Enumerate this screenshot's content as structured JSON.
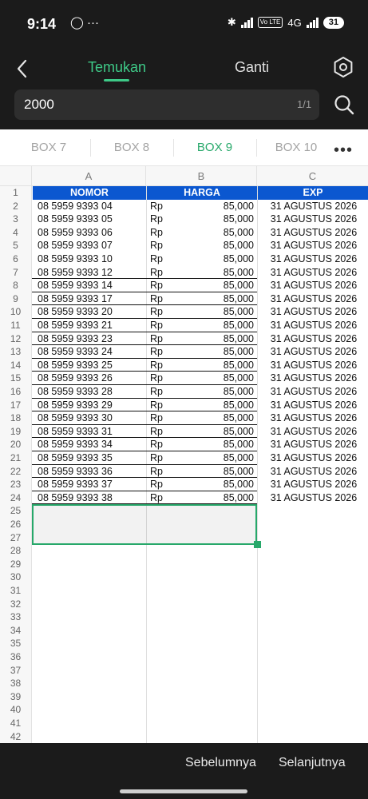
{
  "status": {
    "time": "9:14",
    "left_icons": "◯ ···",
    "net": "4G",
    "volte": "Vo LTE",
    "battery": "31"
  },
  "find": {
    "tab_find": "Temukan",
    "tab_replace": "Ganti",
    "query": "2000",
    "result_count": "1/1"
  },
  "sheet_tabs": [
    "BOX 7",
    "BOX 8",
    "BOX 9",
    "BOX 10"
  ],
  "active_sheet_tab": "BOX 9",
  "columns": [
    "A",
    "B",
    "C"
  ],
  "header_row": {
    "nomor": "NOMOR",
    "harga": "HARGA",
    "exp": "EXP"
  },
  "rows": [
    {
      "nomor": "08 5959 9393 04",
      "rp": "Rp",
      "harga": "85,000",
      "exp": "31 AGUSTUS 2026"
    },
    {
      "nomor": "08 5959 9393 05",
      "rp": "Rp",
      "harga": "85,000",
      "exp": "31 AGUSTUS 2026"
    },
    {
      "nomor": "08 5959 9393 06",
      "rp": "Rp",
      "harga": "85,000",
      "exp": "31 AGUSTUS 2026"
    },
    {
      "nomor": "08 5959 9393 07",
      "rp": "Rp",
      "harga": "85,000",
      "exp": "31 AGUSTUS 2026"
    },
    {
      "nomor": "08 5959 9393 10",
      "rp": "Rp",
      "harga": "85,000",
      "exp": "31 AGUSTUS 2026"
    },
    {
      "nomor": "08 5959 9393 12",
      "rp": "Rp",
      "harga": "85,000",
      "exp": "31 AGUSTUS 2026"
    },
    {
      "nomor": "08 5959 9393 14",
      "rp": "Rp",
      "harga": "85,000",
      "exp": "31 AGUSTUS 2026"
    },
    {
      "nomor": "08 5959 9393 17",
      "rp": "Rp",
      "harga": "85,000",
      "exp": "31 AGUSTUS 2026"
    },
    {
      "nomor": "08 5959 9393 20",
      "rp": "Rp",
      "harga": "85,000",
      "exp": "31 AGUSTUS 2026"
    },
    {
      "nomor": "08 5959 9393 21",
      "rp": "Rp",
      "harga": "85,000",
      "exp": "31 AGUSTUS 2026"
    },
    {
      "nomor": "08 5959 9393 23",
      "rp": "Rp",
      "harga": "85,000",
      "exp": "31 AGUSTUS 2026"
    },
    {
      "nomor": "08 5959 9393 24",
      "rp": "Rp",
      "harga": "85,000",
      "exp": "31 AGUSTUS 2026"
    },
    {
      "nomor": "08 5959 9393 25",
      "rp": "Rp",
      "harga": "85,000",
      "exp": "31 AGUSTUS 2026"
    },
    {
      "nomor": "08 5959 9393 26",
      "rp": "Rp",
      "harga": "85,000",
      "exp": "31 AGUSTUS 2026"
    },
    {
      "nomor": "08 5959 9393 28",
      "rp": "Rp",
      "harga": "85,000",
      "exp": "31 AGUSTUS 2026"
    },
    {
      "nomor": "08 5959 9393 29",
      "rp": "Rp",
      "harga": "85,000",
      "exp": "31 AGUSTUS 2026"
    },
    {
      "nomor": "08 5959 9393 30",
      "rp": "Rp",
      "harga": "85,000",
      "exp": "31 AGUSTUS 2026"
    },
    {
      "nomor": "08 5959 9393 31",
      "rp": "Rp",
      "harga": "85,000",
      "exp": "31 AGUSTUS 2026"
    },
    {
      "nomor": "08 5959 9393 34",
      "rp": "Rp",
      "harga": "85,000",
      "exp": "31 AGUSTUS 2026"
    },
    {
      "nomor": "08 5959 9393 35",
      "rp": "Rp",
      "harga": "85,000",
      "exp": "31 AGUSTUS 2026"
    },
    {
      "nomor": "08 5959 9393 36",
      "rp": "Rp",
      "harga": "85,000",
      "exp": "31 AGUSTUS 2026"
    },
    {
      "nomor": "08 5959 9393 37",
      "rp": "Rp",
      "harga": "85,000",
      "exp": "31 AGUSTUS 2026"
    },
    {
      "nomor": "08 5959 9393 38",
      "rp": "Rp",
      "harga": "85,000",
      "exp": "31 AGUSTUS 2026"
    }
  ],
  "row_numbers": [
    "1",
    "2",
    "3",
    "4",
    "5",
    "6",
    "7",
    "8",
    "9",
    "10",
    "11",
    "12",
    "13",
    "14",
    "15",
    "16",
    "17",
    "18",
    "19",
    "20",
    "21",
    "22",
    "23",
    "24",
    "25",
    "26",
    "27",
    "28",
    "29",
    "30",
    "31",
    "32",
    "33",
    "34",
    "35",
    "36",
    "37",
    "38",
    "39",
    "40",
    "41",
    "42"
  ],
  "selected_range": "A25:B27",
  "bottom": {
    "prev": "Sebelumnya",
    "next": "Selanjutnya"
  },
  "colors": {
    "accent": "#27a86a",
    "header_fill": "#0b57d0",
    "dark_bar": "#1b1b1b"
  }
}
